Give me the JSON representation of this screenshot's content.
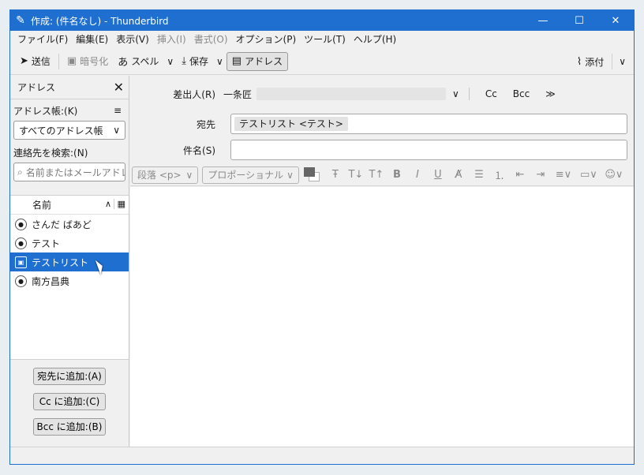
{
  "window": {
    "title": "作成: (件名なし) - Thunderbird"
  },
  "menubar": {
    "items": [
      {
        "label": "ファイル(F)",
        "disabled": false
      },
      {
        "label": "編集(E)",
        "disabled": false
      },
      {
        "label": "表示(V)",
        "disabled": false
      },
      {
        "label": "挿入(I)",
        "disabled": true
      },
      {
        "label": "書式(O)",
        "disabled": true
      },
      {
        "label": "オプション(P)",
        "disabled": false
      },
      {
        "label": "ツール(T)",
        "disabled": false
      },
      {
        "label": "ヘルプ(H)",
        "disabled": false
      }
    ]
  },
  "toolbar": {
    "send": "送信",
    "encrypt": "暗号化",
    "spell": "スペル",
    "save": "保存",
    "address": "アドレス",
    "attach": "添付"
  },
  "sidebar": {
    "title": "アドレス",
    "addressbook_label": "アドレス帳:(K)",
    "addressbook_value": "すべてのアドレス帳",
    "search_label": "連絡先を検索:(N)",
    "search_placeholder": "名前またはメールアドレス",
    "column_name": "名前",
    "contacts": [
      {
        "name": "さんだ ばあど",
        "type": "person"
      },
      {
        "name": "テスト",
        "type": "person"
      },
      {
        "name": "テストリスト",
        "type": "list",
        "selected": true
      },
      {
        "name": "南方昌典",
        "type": "person"
      }
    ],
    "buttons": {
      "add_to": "宛先に追加:(A)",
      "add_cc": "Cc に追加:(C)",
      "add_bcc": "Bcc に追加:(B)"
    }
  },
  "compose": {
    "from_label": "差出人(R)",
    "from_value": "一条匠",
    "cc": "Cc",
    "bcc": "Bcc",
    "more": "≫",
    "to_label": "宛先",
    "to_recipient": "テストリスト <テスト>",
    "subject_label": "件名(S)",
    "subject_value": "",
    "format": {
      "paragraph": "段落 <p>",
      "font": "プロポーショナル"
    }
  }
}
